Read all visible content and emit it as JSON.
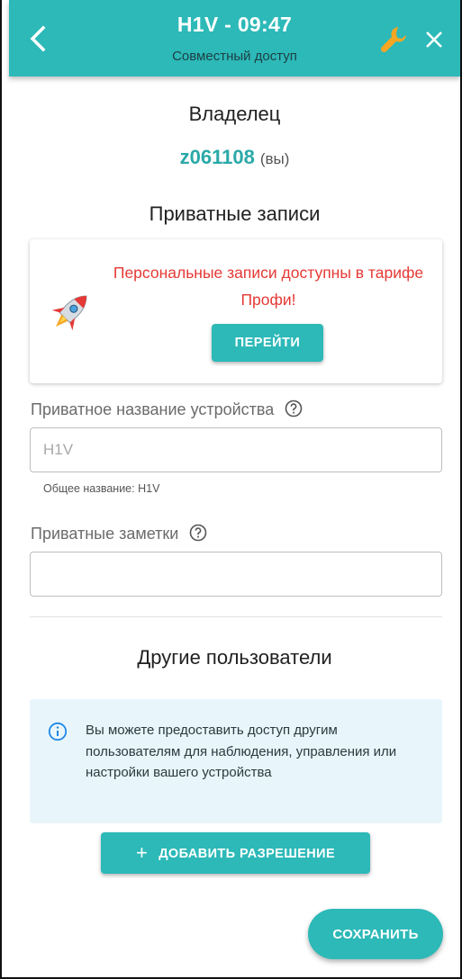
{
  "header": {
    "title": "H1V - 09:47",
    "subtitle": "Совместный доступ",
    "back_icon": "chevron-left-icon",
    "settings_icon": "wrench-icon",
    "close_icon": "close-icon",
    "color": "#2cb9b8"
  },
  "owner": {
    "heading": "Владелец",
    "user_id": "z061108",
    "you_label": "(вы)"
  },
  "private": {
    "heading": "Приватные записи",
    "promo": {
      "icon": "rocket-icon",
      "text": "Персональные записи доступны в тарифе Профи!",
      "button_label": "ПЕРЕЙТИ",
      "text_color": "#e53935"
    },
    "device_name": {
      "label": "Приватное название устройства",
      "placeholder": "H1V",
      "value": "",
      "hint": "Общее название: H1V"
    },
    "notes": {
      "label": "Приватные заметки",
      "placeholder": "",
      "value": ""
    }
  },
  "others": {
    "heading": "Другие пользователи",
    "info_text": "Вы можете предоставить доступ другим пользователям для наблюдения, управления или настройки вашего устройства",
    "add_button_label": "ДОБАВИТЬ РАЗРЕШЕНИЕ",
    "add_button_icon": "plus-icon"
  },
  "save_button_label": "СОХРАНИТЬ"
}
